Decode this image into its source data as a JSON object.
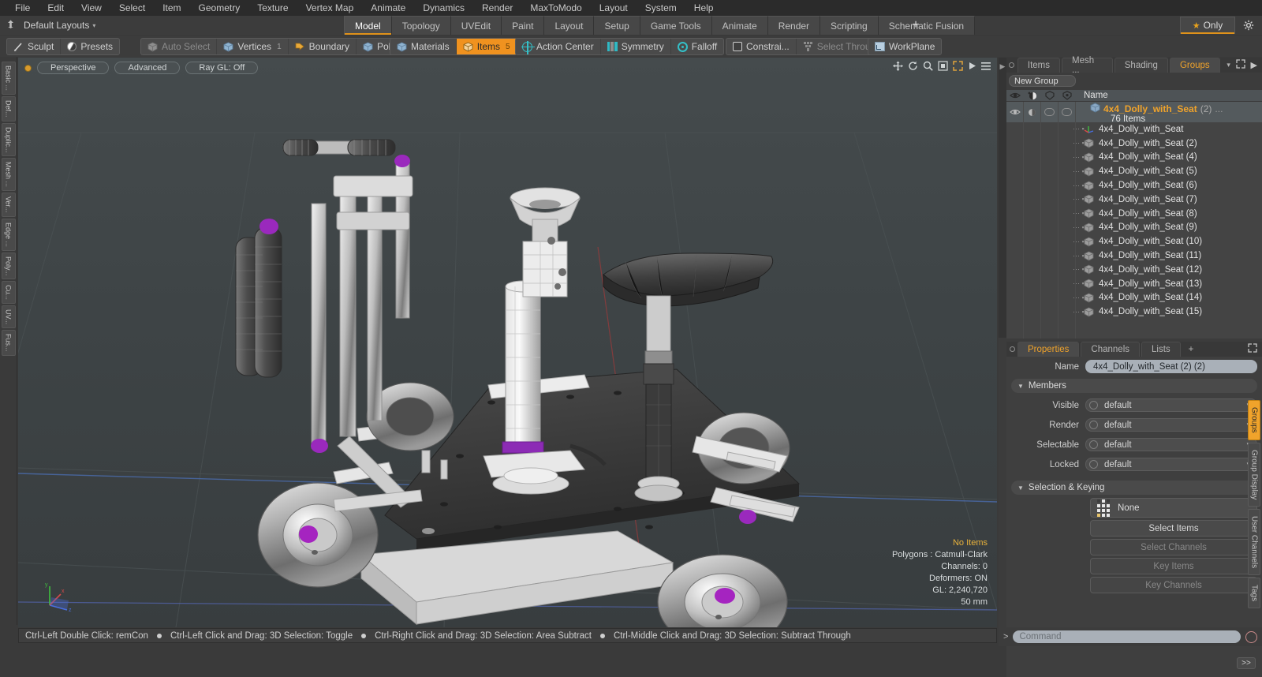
{
  "menu": {
    "items": [
      "File",
      "Edit",
      "View",
      "Select",
      "Item",
      "Geometry",
      "Texture",
      "Vertex Map",
      "Animate",
      "Dynamics",
      "Render",
      "MaxToModo",
      "Layout",
      "System",
      "Help"
    ]
  },
  "layoutbar": {
    "icon": "anchor-icon",
    "label": "Default Layouts",
    "caret": "▾",
    "tabs": [
      {
        "label": "Model",
        "active": true
      },
      {
        "label": "Topology",
        "active": false
      },
      {
        "label": "UVEdit",
        "active": false
      },
      {
        "label": "Paint",
        "active": false
      },
      {
        "label": "Layout",
        "active": false
      },
      {
        "label": "Setup",
        "active": false
      },
      {
        "label": "Game Tools",
        "active": false
      },
      {
        "label": "Animate",
        "active": false
      },
      {
        "label": "Render",
        "active": false
      },
      {
        "label": "Scripting",
        "active": false
      },
      {
        "label": "Schematic Fusion",
        "active": false
      }
    ],
    "add_label": "+",
    "only_label": "Only",
    "star": "★",
    "gear": "✿"
  },
  "toolbar": {
    "group1": [
      {
        "label": "Sculpt",
        "icon": "brush-icon",
        "state": "normal",
        "count": ""
      },
      {
        "label": "Presets",
        "icon": "sphere-icon",
        "state": "normal",
        "count": ""
      }
    ],
    "group2": [
      {
        "label": "Auto Select",
        "icon": "cube-gray-icon",
        "state": "disabled",
        "count": ""
      },
      {
        "label": "Vertices",
        "icon": "cube-blue-icon",
        "state": "normal",
        "count": "1"
      },
      {
        "label": "Boundary",
        "icon": "boundary-icon",
        "state": "normal",
        "count": ""
      },
      {
        "label": "Polygons",
        "icon": "cube-blue-icon",
        "state": "normal",
        "count": ""
      }
    ],
    "group3": [
      {
        "label": "Materials",
        "icon": "cube-blue-icon",
        "state": "normal",
        "count": ""
      },
      {
        "label": "Items",
        "icon": "cube-orange-icon",
        "state": "selected",
        "count": "5"
      }
    ],
    "group4": [
      {
        "label": "Action Center",
        "icon": "crosshair-icon",
        "state": "normal",
        "count": ""
      },
      {
        "label": "Symmetry",
        "icon": "symmetry-icon",
        "state": "normal",
        "count": ""
      },
      {
        "label": "Falloff",
        "icon": "falloff-icon",
        "state": "normal",
        "count": ""
      }
    ],
    "group5": [
      {
        "label": "Constrai...",
        "icon": "constraint-icon",
        "state": "normal",
        "count": ""
      },
      {
        "label": "Select Through",
        "icon": "select-through-icon",
        "state": "disabled",
        "count": ""
      }
    ],
    "group6": [
      {
        "label": "WorkPlane",
        "icon": "workplane-icon",
        "state": "normal",
        "count": ""
      }
    ]
  },
  "left_tool_tabs": [
    "Basic ...",
    "Def...",
    "Duplic...",
    "Mesh ...",
    "Ver...",
    "Edge ...",
    "Poly...",
    "Cu...",
    "UV...",
    "Fus..."
  ],
  "viewport": {
    "controls": [
      {
        "label": "Perspective"
      },
      {
        "label": "Advanced"
      },
      {
        "label": "Ray GL: Off"
      }
    ],
    "tool_icons": [
      "move-icon",
      "rotate-icon",
      "zoom-icon",
      "fit-icon",
      "maximize-icon",
      "play-icon",
      "menu-icon"
    ],
    "info": {
      "no_items": "No Items",
      "polygons": "Polygons : Catmull-Clark",
      "channels": "Channels: 0",
      "deformers": "Deformers: ON",
      "gl": "GL: 2,240,720",
      "focal": "50 mm"
    },
    "axis": {
      "x": "x",
      "y": "y",
      "z": "z"
    }
  },
  "statusbar": {
    "hints": [
      "Ctrl-Left Double Click: remCon",
      "Ctrl-Left Click and Drag: 3D Selection: Toggle",
      "Ctrl-Right Click and Drag: 3D Selection: Area Subtract",
      "Ctrl-Middle Click and Drag: 3D Selection: Subtract Through"
    ]
  },
  "rightpanel": {
    "tabs": [
      {
        "label": "Items",
        "active": false
      },
      {
        "label": "Mesh ...",
        "active": false
      },
      {
        "label": "Shading",
        "active": false
      },
      {
        "label": "Groups",
        "active": true
      }
    ],
    "caret": "▾",
    "expand_icon": "expand-icon",
    "arrow_icon": "chevron-right-icon",
    "new_group_button": "New Group",
    "columns": {
      "eye": "visibility-icon",
      "render": "render-icon",
      "select": "selectable-icon",
      "lock": "lock-icon",
      "name": "Name"
    },
    "group": {
      "name": "4x4_Dolly_with_Seat",
      "index": "(2)",
      "dots": "...",
      "count": "76 Items"
    },
    "items": [
      {
        "label": "4x4_Dolly_with_Seat",
        "icon": "locator-icon"
      },
      {
        "label": "4x4_Dolly_with_Seat (2)",
        "icon": "mesh-icon"
      },
      {
        "label": "4x4_Dolly_with_Seat (4)",
        "icon": "mesh-icon"
      },
      {
        "label": "4x4_Dolly_with_Seat (5)",
        "icon": "mesh-icon"
      },
      {
        "label": "4x4_Dolly_with_Seat (6)",
        "icon": "mesh-icon"
      },
      {
        "label": "4x4_Dolly_with_Seat (7)",
        "icon": "mesh-icon"
      },
      {
        "label": "4x4_Dolly_with_Seat (8)",
        "icon": "mesh-icon"
      },
      {
        "label": "4x4_Dolly_with_Seat (9)",
        "icon": "mesh-icon"
      },
      {
        "label": "4x4_Dolly_with_Seat (10)",
        "icon": "mesh-icon"
      },
      {
        "label": "4x4_Dolly_with_Seat (11)",
        "icon": "mesh-icon"
      },
      {
        "label": "4x4_Dolly_with_Seat (12)",
        "icon": "mesh-icon"
      },
      {
        "label": "4x4_Dolly_with_Seat (13)",
        "icon": "mesh-icon"
      },
      {
        "label": "4x4_Dolly_with_Seat (14)",
        "icon": "mesh-icon"
      },
      {
        "label": "4x4_Dolly_with_Seat (15)",
        "icon": "mesh-icon"
      }
    ]
  },
  "properties": {
    "tabs": [
      {
        "label": "Properties",
        "active": true
      },
      {
        "label": "Channels",
        "active": false
      },
      {
        "label": "Lists",
        "active": false
      }
    ],
    "add_label": "+",
    "name_label": "Name",
    "name_value": "4x4_Dolly_with_Seat (2) (2)",
    "members_header": "Members",
    "members": [
      {
        "label": "Visible",
        "value": "default"
      },
      {
        "label": "Render",
        "value": "default"
      },
      {
        "label": "Selectable",
        "value": "default"
      },
      {
        "label": "Locked",
        "value": "default"
      }
    ],
    "selection_header": "Selection & Keying",
    "none_label": "None",
    "buttons": [
      {
        "label": "Select Items",
        "enabled": true
      },
      {
        "label": "Select Channels",
        "enabled": false
      },
      {
        "label": "Key Items",
        "enabled": false
      },
      {
        "label": "Key Channels",
        "enabled": false
      }
    ],
    "goto_label": ">>"
  },
  "right_vtabs": [
    {
      "label": "Groups",
      "active": true
    },
    {
      "label": "Group Display",
      "active": false
    },
    {
      "label": "User Channels",
      "active": false
    },
    {
      "label": "Tags",
      "active": false
    }
  ],
  "command": {
    "prompt": ">",
    "placeholder": "Command",
    "record_icon": "record-icon"
  },
  "colors": {
    "accent": "#f0a32b",
    "panel_bg": "#3c3c3c",
    "viewport_bg": "#3f4547",
    "field_bg": "#a9b0b8",
    "highlight_text": "#e8b23c"
  }
}
